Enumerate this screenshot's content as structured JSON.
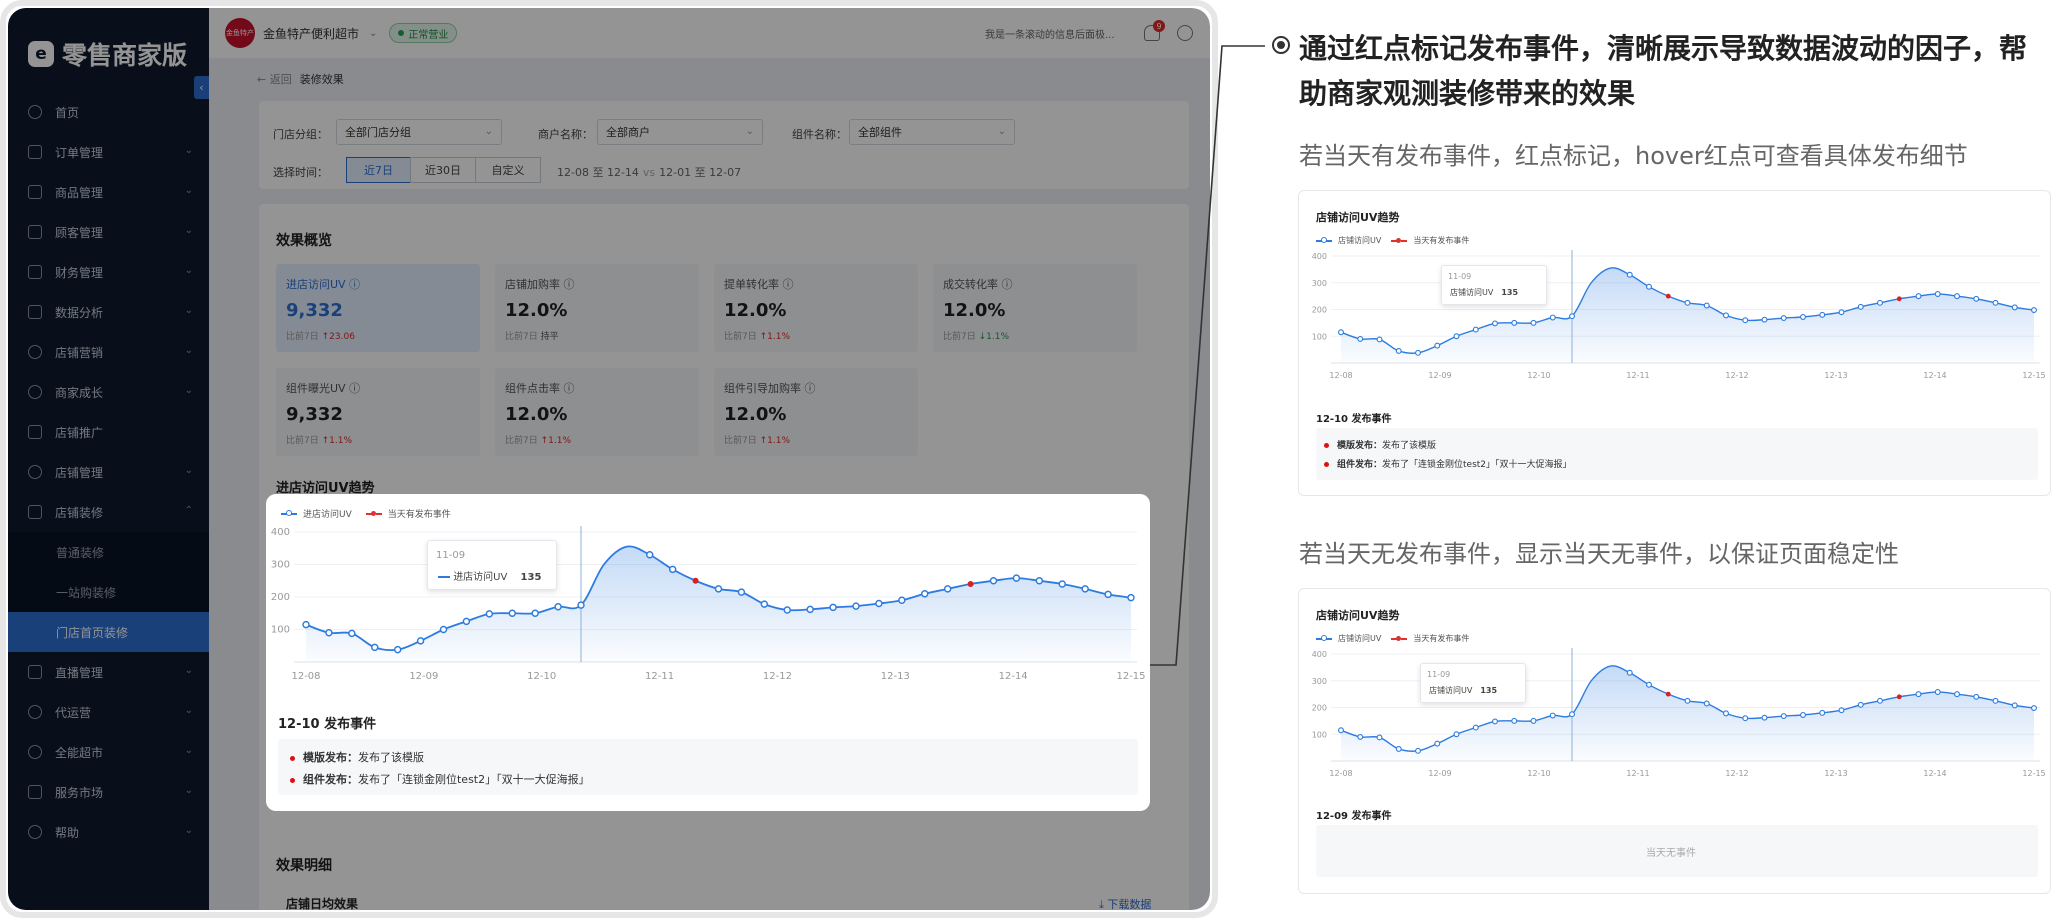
{
  "sidebar": {
    "brand": "零售商家版",
    "brand_mark": "e",
    "collapse_glyph": "‹",
    "items": [
      {
        "label": "首页",
        "icon": "home-icon",
        "chevron": ""
      },
      {
        "label": "订单管理",
        "icon": "order-icon",
        "chevron": "⌄"
      },
      {
        "label": "商品管理",
        "icon": "goods-icon",
        "chevron": "⌄"
      },
      {
        "label": "顾客管理",
        "icon": "customer-icon",
        "chevron": "⌄"
      },
      {
        "label": "财务管理",
        "icon": "finance-icon",
        "chevron": "⌄"
      },
      {
        "label": "数据分析",
        "icon": "analytics-icon",
        "chevron": "⌄"
      },
      {
        "label": "店铺营销",
        "icon": "marketing-icon",
        "chevron": "⌄"
      },
      {
        "label": "商家成长",
        "icon": "growth-icon",
        "chevron": "⌄"
      },
      {
        "label": "店铺推广",
        "icon": "promotion-icon",
        "chevron": ""
      },
      {
        "label": "店铺管理",
        "icon": "store-settings-icon",
        "chevron": "⌄"
      },
      {
        "label": "店铺装修",
        "icon": "decoration-icon",
        "chevron": "⌃"
      }
    ],
    "sub_items": [
      "普通装修",
      "一站购装修",
      "门店首页装修"
    ],
    "bottom_items": [
      {
        "label": "直播管理",
        "icon": "live-icon",
        "chevron": "⌄"
      },
      {
        "label": "代运营",
        "icon": "agency-icon",
        "chevron": "⌄"
      },
      {
        "label": "全能超市",
        "icon": "supermarket-icon",
        "chevron": "⌄"
      },
      {
        "label": "服务市场",
        "icon": "service-market-icon",
        "chevron": "⌄"
      },
      {
        "label": "帮助",
        "icon": "help-icon",
        "chevron": "⌄"
      }
    ]
  },
  "topbar": {
    "store_logo_text": "金鱼特产",
    "store_name": "金鱼特产便利超市",
    "store_chevron": "⌄",
    "status": "正常营业",
    "marquee": "我是一条滚动的信息后面极...",
    "notification_count": "9"
  },
  "breadcrumb": {
    "back": "← 返回",
    "current": "装修效果"
  },
  "filters": {
    "group_label": "门店分组：",
    "group_value": "全部门店分组",
    "merchant_label": "商户名称：",
    "merchant_value": "全部商户",
    "component_label": "组件名称：",
    "component_value": "全部组件",
    "time_label": "选择时间：",
    "time_options": [
      "近7日",
      "近30日",
      "自定义"
    ],
    "date_from": "12-08 至 12-14",
    "vs": "vs",
    "date_to": "12-01 至 12-07",
    "chevron": "⌄"
  },
  "overview": {
    "title": "效果概览",
    "kpis": [
      {
        "label": "进店访问UV ⓘ",
        "value": "9,332",
        "compare": "比前7日",
        "trend": "↑23.06",
        "trend_class": "up"
      },
      {
        "label": "店铺加购率 ⓘ",
        "value": "12.0%",
        "compare": "比前7日",
        "trend": "持平",
        "trend_class": "flat"
      },
      {
        "label": "提单转化率 ⓘ",
        "value": "12.0%",
        "compare": "比前7日",
        "trend": "↑1.1%",
        "trend_class": "up"
      },
      {
        "label": "成交转化率 ⓘ",
        "value": "12.0%",
        "compare": "比前7日",
        "trend": "↓1.1%",
        "trend_class": "down"
      },
      {
        "label": "组件曝光UV ⓘ",
        "value": "9,332",
        "compare": "比前7日",
        "trend": "↑1.1%",
        "trend_class": "up"
      },
      {
        "label": "组件点击率 ⓘ",
        "value": "12.0%",
        "compare": "比前7日",
        "trend": "↑1.1%",
        "trend_class": "up"
      },
      {
        "label": "组件引导加购率 ⓘ",
        "value": "12.0%",
        "compare": "比前7日",
        "trend": "↑1.1%",
        "trend_class": "up"
      }
    ]
  },
  "trend_title": "进店访问UV趋势",
  "legend": {
    "series": "进店访问UV",
    "events": "当天有发布事件"
  },
  "tooltip": {
    "date": "11-09",
    "label": "进店访问UV",
    "value": "135"
  },
  "events": {
    "title": "12-10 发布事件",
    "items": [
      {
        "key": "模版发布：",
        "text": "发布了该模版"
      },
      {
        "key": "组件发布：",
        "text": "发布了「连锁金刚位test2」「双十一大促海报」"
      }
    ]
  },
  "detail": {
    "title": "效果明细",
    "sub_title": "店铺日均效果",
    "download": "⤓ 下载数据"
  },
  "annotation": {
    "headline": "通过红点标记发布事件，清晰展示导致数据波动的因子，帮助商家观测装修带来的效果",
    "case1": "若当天有发布事件，红点标记，hover红点可查看具体发布细节",
    "case2": "若当天无发布事件，显示当天无事件，以保证页面稳定性"
  },
  "side_card_1": {
    "title": "店铺访问UV趋势",
    "legend_series": "店铺访问UV",
    "legend_events": "当天有发布事件",
    "tooltip_date": "11-09",
    "tooltip_label": "店铺访问UV",
    "tooltip_value": "135",
    "events_title": "12-10 发布事件",
    "events": [
      {
        "key": "模版发布：",
        "text": "发布了该模版"
      },
      {
        "key": "组件发布：",
        "text": "发布了「连锁金刚位test2」「双十一大促海报」"
      }
    ]
  },
  "side_card_2": {
    "title": "店铺访问UV趋势",
    "legend_series": "店铺访问UV",
    "legend_events": "当天有发布事件",
    "tooltip_date": "11-09",
    "tooltip_label": "店铺访问UV",
    "tooltip_value": "135",
    "events_title": "12-09 发布事件",
    "no_event": "当天无事件"
  },
  "colors": {
    "accent": "#2d6fd3",
    "line": "#2d7be0",
    "event": "#d92020",
    "sidebar": "#0f1b2e"
  },
  "chart_data": {
    "type": "line",
    "x_ticks": [
      "12-08",
      "12-09",
      "12-10",
      "12-11",
      "12-12",
      "12-13",
      "12-14",
      "12-15"
    ],
    "y_ticks": [
      100,
      200,
      300,
      400
    ],
    "ylim": [
      0,
      400
    ],
    "series": [
      {
        "name": "进店访问UV",
        "values": [
          115,
          90,
          88,
          45,
          38,
          65,
          100,
          125,
          148,
          150,
          150,
          170,
          175,
          300,
          355,
          330,
          285,
          250,
          225,
          215,
          178,
          160,
          162,
          168,
          172,
          180,
          190,
          210,
          225,
          240,
          250,
          258,
          250,
          240,
          225,
          208,
          198
        ]
      }
    ],
    "event_indices": [
      17,
      29
    ],
    "hover_index": 12,
    "grid": true,
    "legend": "top-left"
  }
}
